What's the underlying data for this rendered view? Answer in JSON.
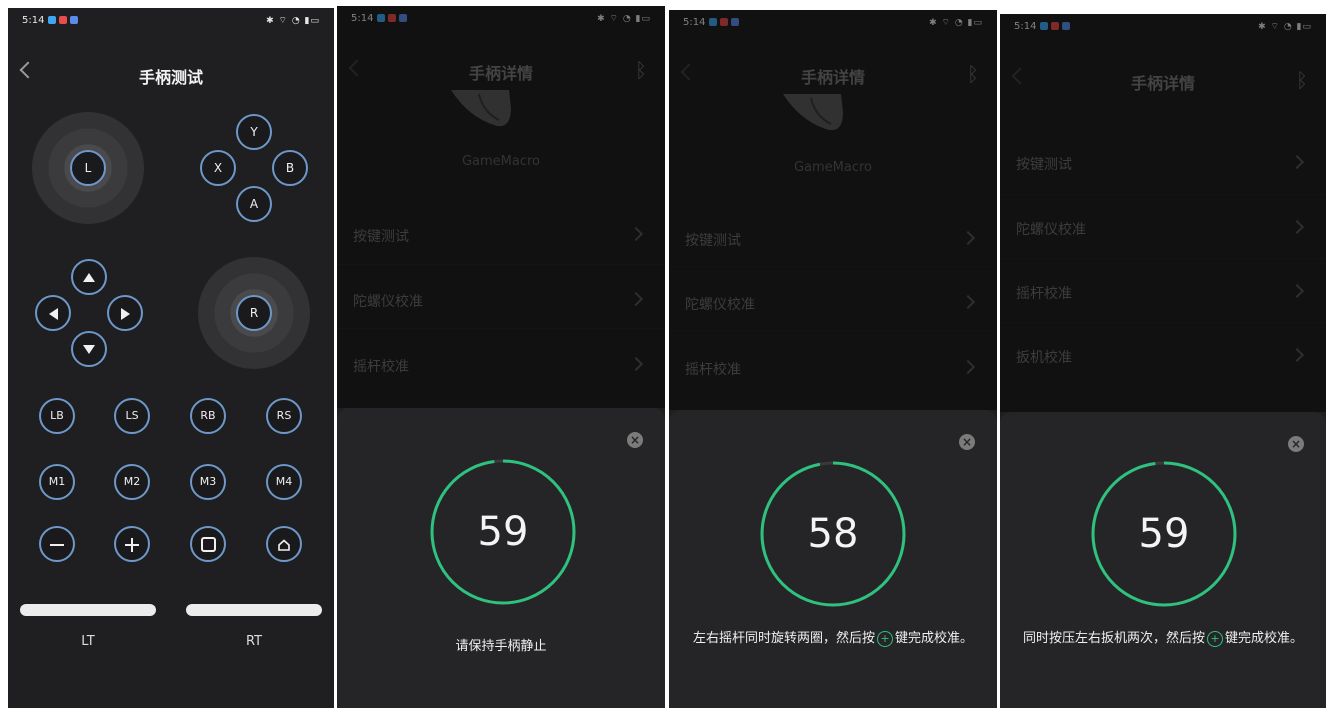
{
  "status_time": "5:14",
  "colors": {
    "accent": "#6d98c9",
    "ring": "#2ec27e",
    "background": "#1f1f21"
  },
  "screen1": {
    "title": "手柄测试",
    "left_stick": "L",
    "right_stick": "R",
    "face_buttons": {
      "y": "Y",
      "x": "X",
      "b": "B",
      "a": "A"
    },
    "row1": [
      "LB",
      "LS",
      "RB",
      "RS"
    ],
    "row2": [
      "M1",
      "M2",
      "M3",
      "M4"
    ],
    "triggers": {
      "left": "LT",
      "right": "RT"
    }
  },
  "details": {
    "title": "手柄详情",
    "product_name": "GameMacro",
    "menu": [
      "按键测试",
      "陀螺仪校准",
      "摇杆校准",
      "扳机校准"
    ]
  },
  "screen2": {
    "countdown": "59",
    "instruction": "请保持手柄静止",
    "progress": 0.98
  },
  "screen3": {
    "countdown": "58",
    "instruction_before": "左右摇杆同时旋转两圈，然后按",
    "instruction_after": "键完成校准。",
    "progress": 0.97
  },
  "screen4": {
    "countdown": "59",
    "instruction_before": "同时按压左右扳机两次，然后按",
    "instruction_after": "键完成校准。",
    "progress": 0.98
  }
}
